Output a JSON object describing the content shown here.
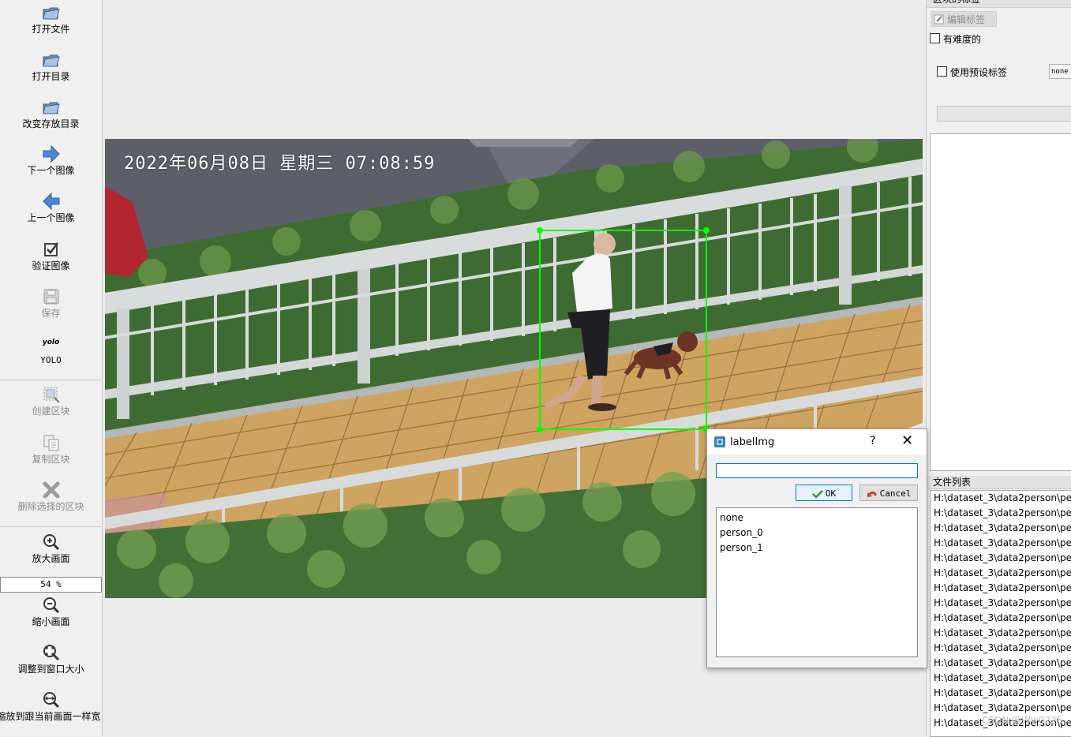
{
  "toolbar": {
    "items": [
      {
        "label": "打开文件",
        "icon": "open-file-icon",
        "enabled": true
      },
      {
        "label": "打开目录",
        "icon": "open-dir-icon",
        "enabled": true
      },
      {
        "label": "改变存放目录",
        "icon": "change-save-dir-icon",
        "enabled": true
      },
      {
        "label": "下一个图像",
        "icon": "next-image-icon",
        "enabled": true
      },
      {
        "label": "上一个图像",
        "icon": "prev-image-icon",
        "enabled": true
      },
      {
        "label": "验证图像",
        "icon": "verify-image-icon",
        "enabled": true
      },
      {
        "label": "保存",
        "icon": "save-icon",
        "enabled": false
      },
      {
        "label": "YOLO",
        "icon": "yolo-format-icon",
        "icon_text": "yolo",
        "enabled": true
      },
      {
        "label": "创建区块",
        "icon": "create-box-icon",
        "enabled": false
      },
      {
        "label": "复制区块",
        "icon": "copy-box-icon",
        "enabled": false
      },
      {
        "label": "删除选择的区块",
        "icon": "delete-box-icon",
        "enabled": false
      },
      {
        "label": "放大画面",
        "icon": "zoom-in-icon",
        "enabled": true
      },
      {
        "label": "缩小画面",
        "icon": "zoom-out-icon",
        "enabled": true
      },
      {
        "label": "调整到窗口大小",
        "icon": "fit-window-icon",
        "enabled": true
      },
      {
        "label": "缩放到跟当前画面一样宽",
        "icon": "fit-width-icon",
        "enabled": true
      }
    ],
    "zoom_value": "54 %"
  },
  "canvas": {
    "timestamp": "2022年06月08日 星期三 07:08:59",
    "box_color": "#00ff00"
  },
  "right_panel": {
    "labels_dock_title": "区块的标签",
    "edit_label_button": "编辑标签",
    "difficult_label": "有难度的",
    "use_default_label": "使用预设标签",
    "default_label_value": "none",
    "file_list_title": "文件列表",
    "files": [
      "H:\\dataset_3\\data2person\\pe",
      "H:\\dataset_3\\data2person\\pe",
      "H:\\dataset_3\\data2person\\pe",
      "H:\\dataset_3\\data2person\\pe",
      "H:\\dataset_3\\data2person\\pe",
      "H:\\dataset_3\\data2person\\pe",
      "H:\\dataset_3\\data2person\\pe",
      "H:\\dataset_3\\data2person\\pe",
      "H:\\dataset_3\\data2person\\pe",
      "H:\\dataset_3\\data2person\\pe",
      "H:\\dataset_3\\data2person\\pe",
      "H:\\dataset_3\\data2person\\pe",
      "H:\\dataset_3\\data2person\\pe",
      "H:\\dataset_3\\data2person\\pe",
      "H:\\dataset_3\\data2person\\pe",
      "H:\\dataset_3\\data2person\\pe"
    ]
  },
  "dialog": {
    "title": "labelImg",
    "help_glyph": "?",
    "close_glyph": "✕",
    "input_value": "",
    "ok_label": "OK",
    "cancel_label": "Cancel",
    "items": [
      "none",
      "person_0",
      "person_1"
    ]
  },
  "watermark": "CSDN @Ww0225"
}
